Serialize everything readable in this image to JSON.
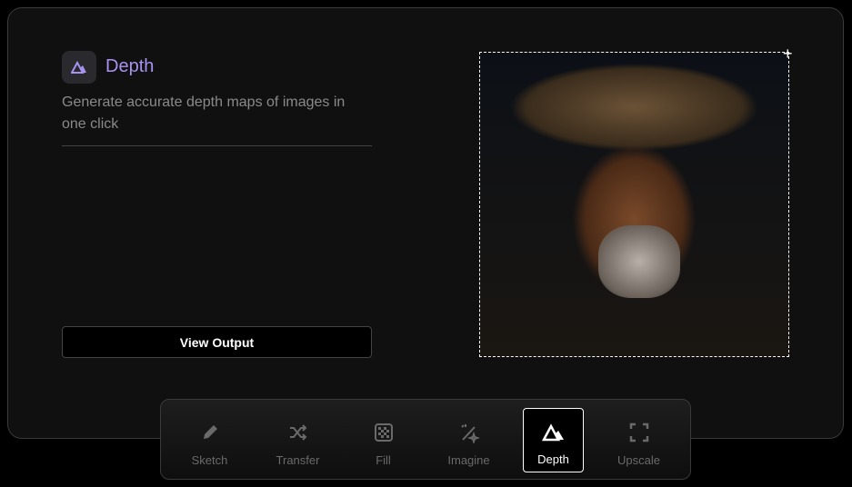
{
  "header": {
    "title": "Depth",
    "description": "Generate accurate depth maps of images in one click"
  },
  "actions": {
    "view_output": "View Output"
  },
  "image": {
    "alt": "Portrait of elderly man with straw hat"
  },
  "toolbar": {
    "active": "Depth",
    "items": [
      {
        "label": "Sketch",
        "icon": "pencil-icon"
      },
      {
        "label": "Transfer",
        "icon": "shuffle-icon"
      },
      {
        "label": "Fill",
        "icon": "checkerboard-icon"
      },
      {
        "label": "Imagine",
        "icon": "magic-wand-icon"
      },
      {
        "label": "Depth",
        "icon": "mountain-icon"
      },
      {
        "label": "Upscale",
        "icon": "expand-icon"
      }
    ]
  },
  "colors": {
    "accent": "#a892f0"
  }
}
